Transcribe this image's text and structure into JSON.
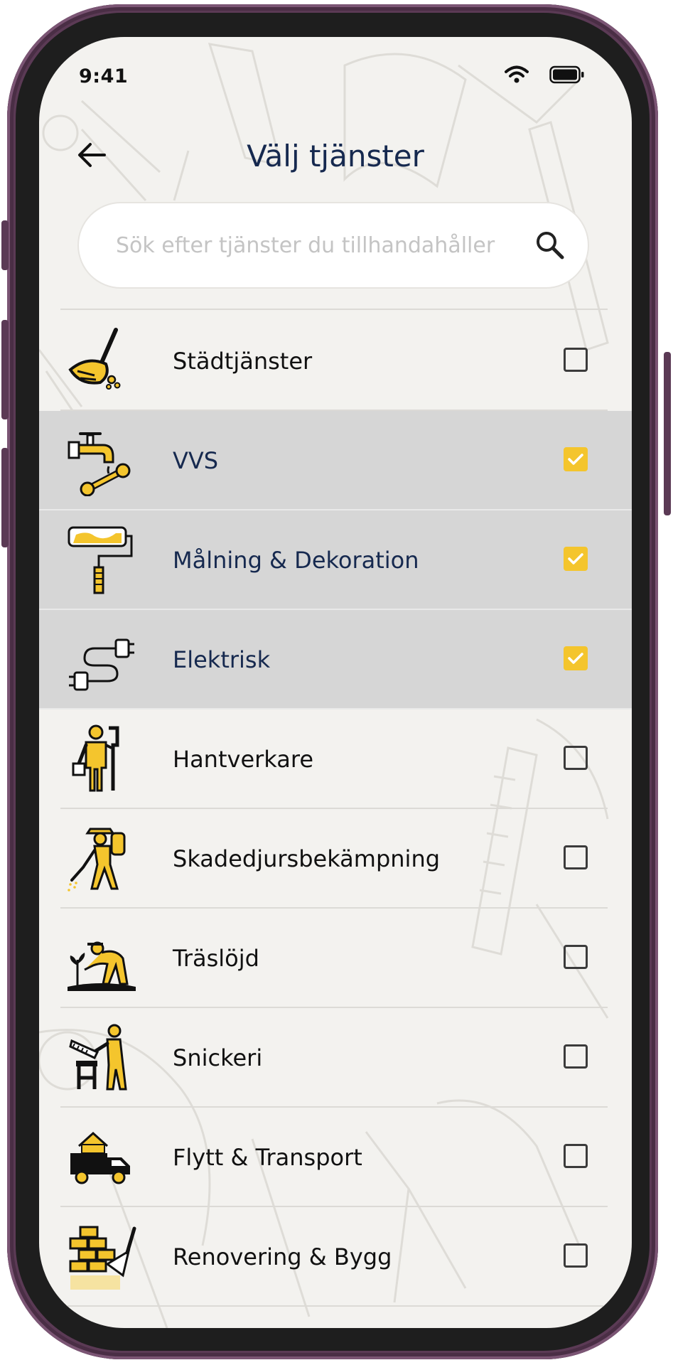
{
  "status_bar": {
    "time": "9:41",
    "wifi_icon": "wifi-icon",
    "battery_icon": "battery-icon"
  },
  "header": {
    "title": "Välj tjänster",
    "back_icon": "arrow-left-icon"
  },
  "search": {
    "placeholder": "Sök efter tjänster du tillhandahåller",
    "value": "",
    "icon": "search-icon"
  },
  "colors": {
    "accent": "#f4c52d",
    "title": "#16294f",
    "selected_row": "#d6d6d6",
    "background": "#f3f2ef"
  },
  "services": [
    {
      "label": "Städtjänster",
      "icon": "broom-icon",
      "checked": false
    },
    {
      "label": "VVS",
      "icon": "faucet-wrench-icon",
      "checked": true
    },
    {
      "label": "Målning & Dekoration",
      "icon": "paint-roller-icon",
      "checked": true
    },
    {
      "label": "Elektrisk",
      "icon": "electric-plug-icon",
      "checked": true
    },
    {
      "label": "Hantverkare",
      "icon": "handyman-icon",
      "checked": false
    },
    {
      "label": "Skadedjursbekämpning",
      "icon": "pest-control-icon",
      "checked": false
    },
    {
      "label": "Träslöjd",
      "icon": "gardener-icon",
      "checked": false
    },
    {
      "label": "Snickeri",
      "icon": "carpenter-saw-icon",
      "checked": false
    },
    {
      "label": "Flytt & Transport",
      "icon": "moving-truck-icon",
      "checked": false
    },
    {
      "label": "Renovering & Bygg",
      "icon": "bricks-trowel-icon",
      "checked": false
    }
  ]
}
